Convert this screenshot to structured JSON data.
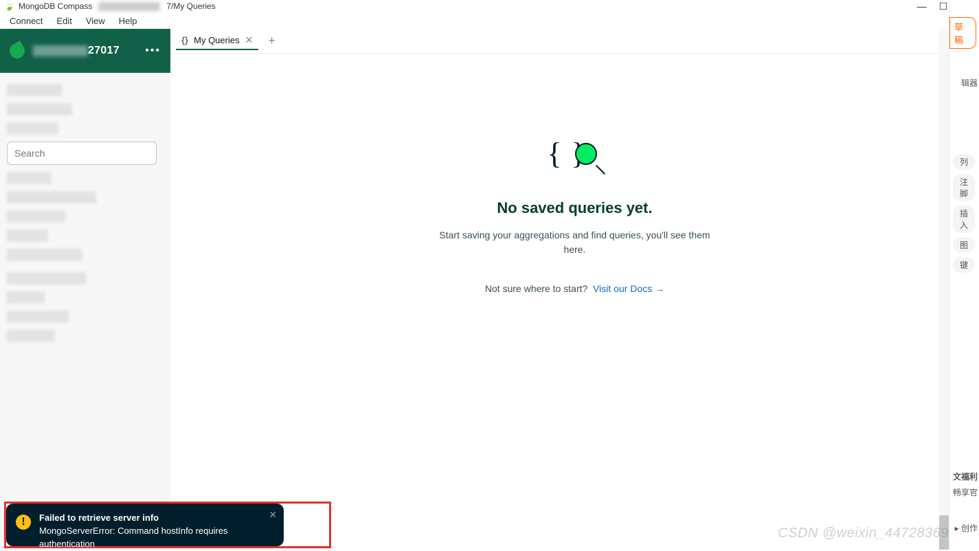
{
  "window": {
    "app_name": "MongoDB Compass",
    "title_suffix": "7/My Queries",
    "controls": {
      "min": "—",
      "max": "☐",
      "close": "✕"
    }
  },
  "menubar": [
    "Connect",
    "Edit",
    "View",
    "Help"
  ],
  "connection": {
    "host_suffix": "27017",
    "menu_icon": "•••"
  },
  "sidebar": {
    "search_placeholder": "Search"
  },
  "tabs": [
    {
      "label": "My Queries",
      "active": true
    }
  ],
  "empty_state": {
    "heading": "No saved queries yet.",
    "body": "Start saving your aggregations and find queries, you'll see them here.",
    "prompt_text": "Not sure where to start?",
    "link_text": "Visit our Docs →"
  },
  "toast": {
    "title": "Failed to retrieve server info",
    "body": "MongoServerError: Command hostInfo requires authentication",
    "warn_glyph": "!"
  },
  "right_panel": {
    "draft": "草稿",
    "editor_label": "辑器",
    "pills": [
      "列",
      "注脚",
      "插入",
      "图",
      "键"
    ],
    "promo1": "文福利",
    "promo2": "畅享官",
    "create": "▸ 创作"
  },
  "watermark": "CSDN @weixin_44728369"
}
